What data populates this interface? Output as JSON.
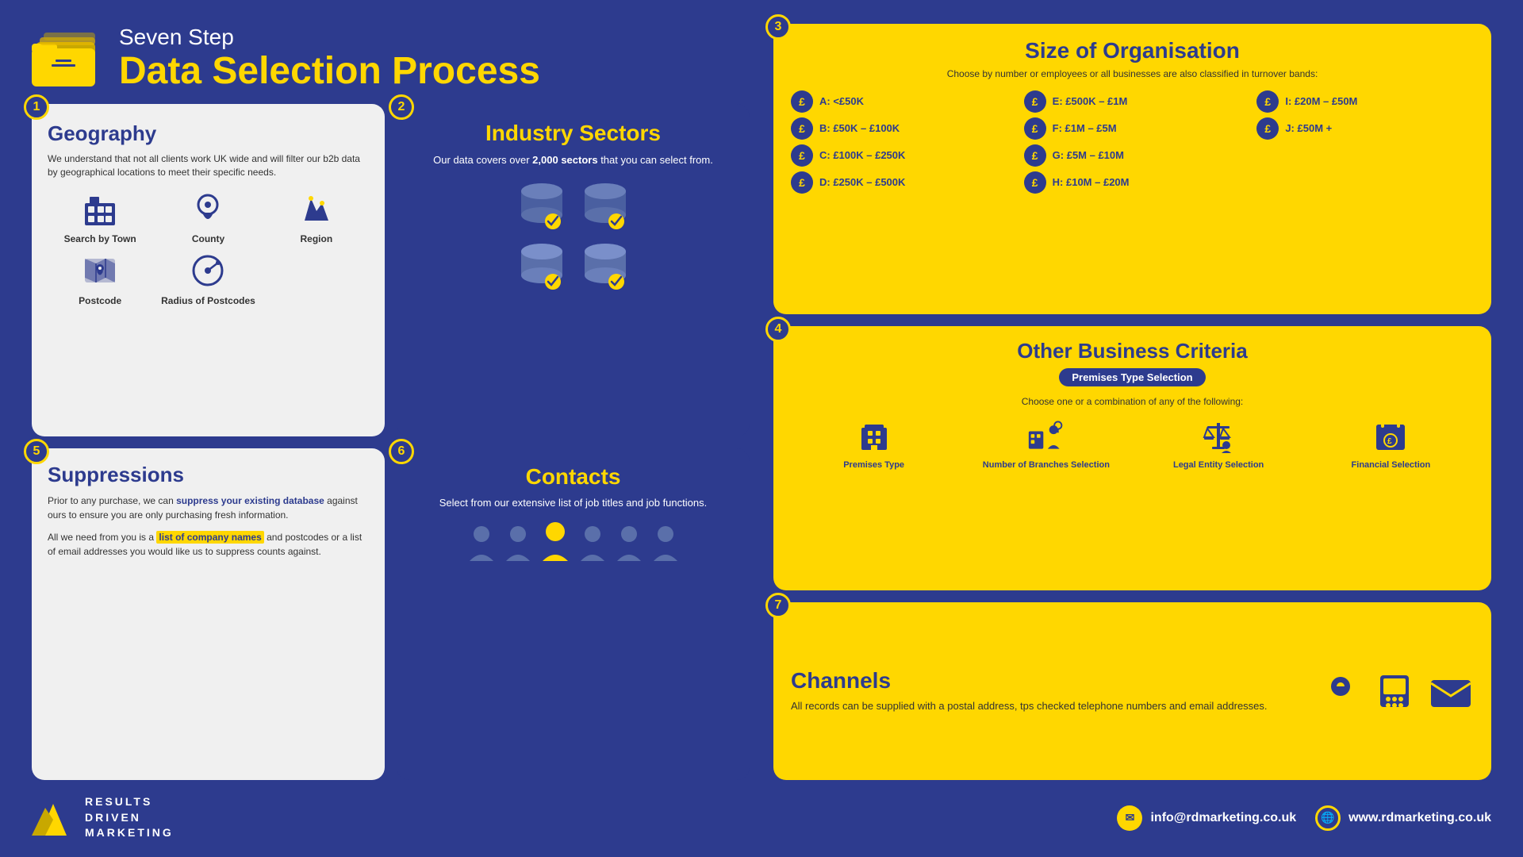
{
  "header": {
    "subtitle": "Seven Step",
    "title": "Data Selection Process"
  },
  "steps": {
    "step1": {
      "number": "1",
      "title": "Geography",
      "description": "We understand that not all clients work UK wide and will filter our b2b data by geographical locations to meet their specific needs.",
      "geo_items": [
        {
          "label": "Search by Town"
        },
        {
          "label": "County"
        },
        {
          "label": "Region"
        },
        {
          "label": "Postcode"
        },
        {
          "label": "Radius of Postcodes"
        }
      ]
    },
    "step2": {
      "number": "2",
      "title": "Industry Sectors",
      "description_pre": "Our data covers over ",
      "highlight": "2,000 sectors",
      "description_post": " that you can select from."
    },
    "step3": {
      "number": "3",
      "title": "Size of Organisation",
      "description": "Choose by number or employees or all businesses are also classified in turnover bands:",
      "bands": [
        {
          "code": "A",
          "label": "A: <£50K"
        },
        {
          "code": "B",
          "label": "B: £50K – £100K"
        },
        {
          "code": "C",
          "label": "C: £100K – £250K"
        },
        {
          "code": "D",
          "label": "D: £250K – £500K"
        },
        {
          "code": "E",
          "label": "E: £500K – £1M"
        },
        {
          "code": "F",
          "label": "F: £1M – £5M"
        },
        {
          "code": "G",
          "label": "G: £5M – £10M"
        },
        {
          "code": "H",
          "label": "H: £10M – £20M"
        },
        {
          "code": "I",
          "label": "I: £20M – £50M"
        },
        {
          "code": "J",
          "label": "J: £50M +"
        }
      ]
    },
    "step4": {
      "number": "4",
      "title": "Other Business Criteria",
      "badge": "Premises Type Selection",
      "subdesc": "Choose one or a combination of any of the following:",
      "criteria": [
        {
          "label": "Premises Type"
        },
        {
          "label": "Number of Branches Selection"
        },
        {
          "label": "Legal Entity Selection"
        },
        {
          "label": "Financial Selection"
        }
      ]
    },
    "step5": {
      "number": "5",
      "title": "Suppressions",
      "para1": "Prior to any purchase, we can suppress your existing database against ours to ensure you are only purchasing fresh information.",
      "highlight": "list of company names",
      "para2_pre": "All we need from you is a ",
      "para2_post": " and postcodes or a list of email addresses you would like us to suppress counts against."
    },
    "step6": {
      "number": "6",
      "title": "Contacts",
      "description": "Select from our extensive list of job titles and job functions."
    },
    "step7": {
      "number": "7",
      "title": "Channels",
      "description": "All records can be supplied with a postal address, tps checked telephone numbers and email addresses."
    }
  },
  "footer": {
    "brand": {
      "lines": [
        "RESULTS",
        "DRIVEN",
        "MARKETING"
      ]
    },
    "email": "info@rdmarketing.co.uk",
    "website": "www.rdmarketing.co.uk"
  }
}
